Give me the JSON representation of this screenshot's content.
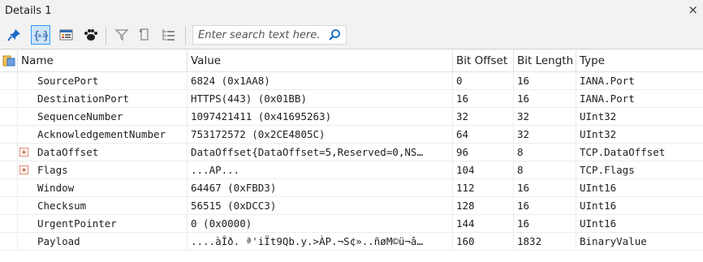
{
  "window": {
    "title": "Details 1",
    "close": "×"
  },
  "toolbar": {
    "icons": [
      "pin-icon",
      "object-view-icon",
      "list-view-icon",
      "paw-icon",
      "filter-icon",
      "bookmark-icon",
      "tree-collapse-icon"
    ],
    "search_placeholder": "Enter search text here..."
  },
  "table": {
    "columns": [
      "Name",
      "Value",
      "Bit Offset",
      "Bit Length",
      "Type"
    ],
    "rows": [
      {
        "name": "SourcePort",
        "value": "6824 (0x1AA8)",
        "bit_offset": "0",
        "bit_length": "16",
        "type": "IANA.Port",
        "expandable": false
      },
      {
        "name": "DestinationPort",
        "value": "HTTPS(443) (0x01BB)",
        "bit_offset": "16",
        "bit_length": "16",
        "type": "IANA.Port",
        "expandable": false
      },
      {
        "name": "SequenceNumber",
        "value": "1097421411 (0x41695263)",
        "bit_offset": "32",
        "bit_length": "32",
        "type": "UInt32",
        "expandable": false
      },
      {
        "name": "AcknowledgementNumber",
        "value": "753172572 (0x2CE4805C)",
        "bit_offset": "64",
        "bit_length": "32",
        "type": "UInt32",
        "expandable": false
      },
      {
        "name": "DataOffset",
        "value": "DataOffset{DataOffset=5,Reserved=0,NS…",
        "bit_offset": "96",
        "bit_length": "8",
        "type": "TCP.DataOffset",
        "expandable": true
      },
      {
        "name": "Flags",
        "value": "...AP...",
        "bit_offset": "104",
        "bit_length": "8",
        "type": "TCP.Flags",
        "expandable": true
      },
      {
        "name": "Window",
        "value": "64467 (0xFBD3)",
        "bit_offset": "112",
        "bit_length": "16",
        "type": "UInt16",
        "expandable": false
      },
      {
        "name": "Checksum",
        "value": "56515 (0xDCC3)",
        "bit_offset": "128",
        "bit_length": "16",
        "type": "UInt16",
        "expandable": false
      },
      {
        "name": "UrgentPointer",
        "value": "0 (0x0000)",
        "bit_offset": "144",
        "bit_length": "16",
        "type": "UInt16",
        "expandable": false
      },
      {
        "name": "Payload",
        "value": "....àÎð. ª'iÏt9Qb.y.>ÀP.¬S¢»..ñøM©ü¬â…",
        "bit_offset": "160",
        "bit_length": "1832",
        "type": "BinaryValue",
        "expandable": false
      }
    ]
  }
}
